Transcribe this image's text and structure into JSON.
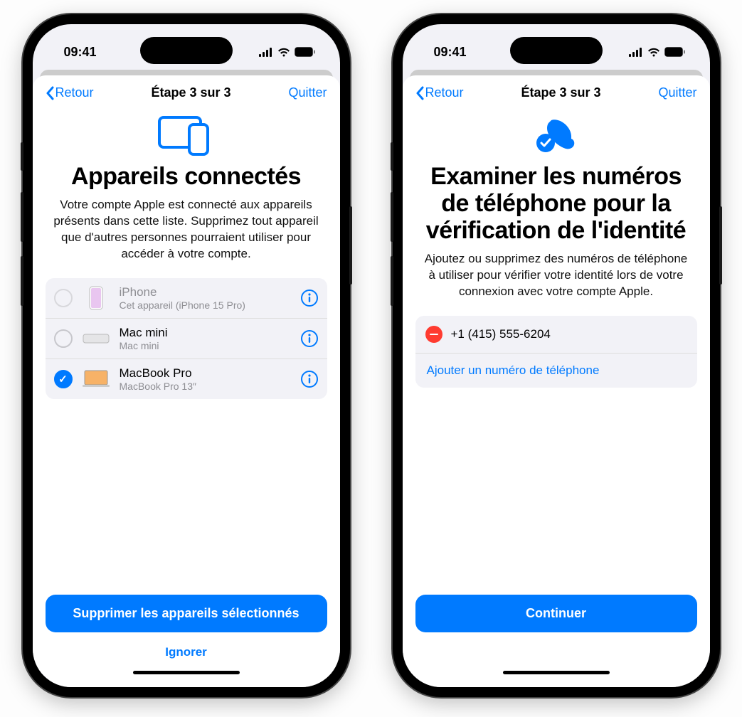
{
  "status": {
    "time": "09:41"
  },
  "nav": {
    "back": "Retour",
    "step": "Étape 3 sur 3",
    "quit": "Quitter"
  },
  "left": {
    "title": "Appareils connectés",
    "desc": "Votre compte Apple est connecté aux appareils présents dans cette liste. Supprimez tout appareil que d'autres personnes pourraient utiliser pour accéder à votre compte.",
    "devices": [
      {
        "name": "iPhone",
        "sub": "Cet appareil (iPhone 15 Pro)",
        "checked": false,
        "disabled": true,
        "icon": "iphone"
      },
      {
        "name": "Mac mini",
        "sub": "Mac mini",
        "checked": false,
        "disabled": false,
        "icon": "macmini"
      },
      {
        "name": "MacBook Pro",
        "sub": "MacBook Pro 13″",
        "checked": true,
        "disabled": false,
        "icon": "macbook"
      }
    ],
    "primary": "Supprimer les appareils sélectionnés",
    "skip": "Ignorer"
  },
  "right": {
    "title": "Examiner les numéros de téléphone pour la vérification de l'identité",
    "desc": "Ajoutez ou supprimez des numéros de téléphone à utiliser pour vérifier votre identité lors de votre connexion avec votre compte Apple.",
    "phone": "+1 (415) 555-6204",
    "add": "Ajouter un numéro de téléphone",
    "primary": "Continuer"
  }
}
